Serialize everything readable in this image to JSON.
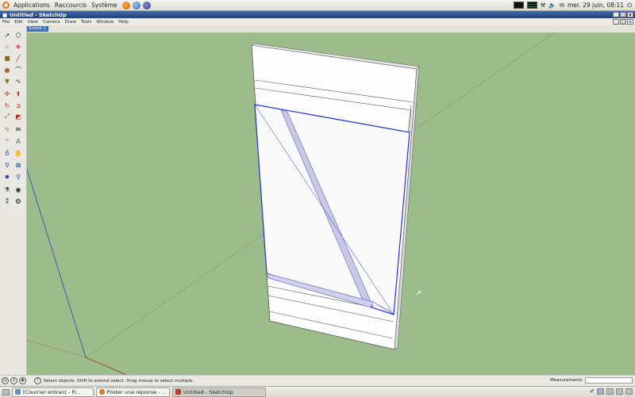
{
  "top_panel": {
    "menus": [
      "Applications",
      "Raccourcis",
      "Système"
    ],
    "clock": "mer. 29 juin, 08:11"
  },
  "window": {
    "title": "Untitled - SketchUp",
    "menus": [
      "File",
      "Edit",
      "View",
      "Camera",
      "Draw",
      "Tools",
      "Window",
      "Help"
    ],
    "scene_tab": "Scene 1"
  },
  "status": {
    "hint": "Select objects. Shift to extend select. Drag mouse to select multiple.",
    "measurements_label": "Measurements",
    "measurements_value": ""
  },
  "taskbar": {
    "items": [
      {
        "label": "[Courrier entrant - Fr..."
      },
      {
        "label": "Poster une réponse - ..."
      },
      {
        "label": "Untitled - SketchUp"
      }
    ]
  },
  "colors": {
    "viewport_bg": "#9cbc8c",
    "title_bar": "#2a4f8e",
    "selection_blue": "#1f2fd8",
    "axis_blue": "#3b5fb0",
    "axis_green": "#4f9a4f",
    "axis_red": "#a04a3a"
  },
  "icons": [
    "select-icon",
    "component-icon",
    "paint-bucket-icon",
    "eraser-icon",
    "rectangle-icon",
    "line-icon",
    "circle-icon",
    "arc-icon",
    "polygon-icon",
    "freehand-icon",
    "move-icon",
    "push-pull-icon",
    "rotate-icon",
    "follow-me-icon",
    "scale-icon",
    "offset-icon",
    "tape-measure-icon",
    "text-icon",
    "axes-icon",
    "3d-text-icon",
    "orbit-icon",
    "pan-icon",
    "zoom-icon",
    "zoom-window-icon",
    "zoom-extents-icon",
    "previous-view-icon",
    "walk-icon",
    "look-around-icon",
    "footprints-icon",
    "section-plane-icon"
  ]
}
